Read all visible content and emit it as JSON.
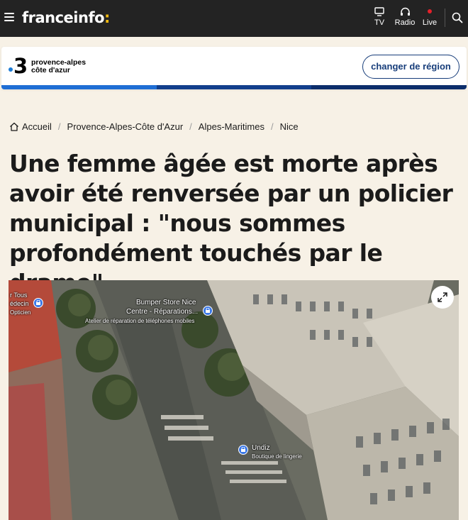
{
  "header": {
    "logo_text": "franceinfo",
    "logo_colon": ":",
    "nav": [
      {
        "label": "TV",
        "icon": "tv-icon"
      },
      {
        "label": "Radio",
        "icon": "headphones-icon"
      },
      {
        "label": "Live",
        "icon": "live-dot-icon"
      }
    ],
    "colors": {
      "background": "#232323",
      "accent": "#f2b90f",
      "live": "#e4202a"
    }
  },
  "region": {
    "channel_number": "3",
    "name_line1": "provence-alpes",
    "name_line2": "côte d'azur",
    "change_button": "changer de région",
    "colors": {
      "button": "#173d7a",
      "dot": "#1d7cd6"
    }
  },
  "breadcrumb": [
    {
      "label": "Accueil",
      "icon": "home-icon"
    },
    {
      "label": "Provence-Alpes-Côte d'Azur"
    },
    {
      "label": "Alpes-Maritimes"
    },
    {
      "label": "Nice"
    }
  ],
  "article": {
    "title": "Une femme âgée est morte après avoir été renversée par un policier municipal : \"nous sommes profondément touchés par le drame\""
  },
  "hero_map": {
    "labels": {
      "top_left_1": "r Tous",
      "top_left_2": "édecin",
      "top_left_3": "Opticien",
      "store_name_1": "Bumper Store Nice",
      "store_name_2": "Centre - Réparations...",
      "store_category": "Atelier de réparation de téléphones mobiles",
      "shop_name": "Undiz",
      "shop_category": "Boutique de lingerie"
    }
  }
}
